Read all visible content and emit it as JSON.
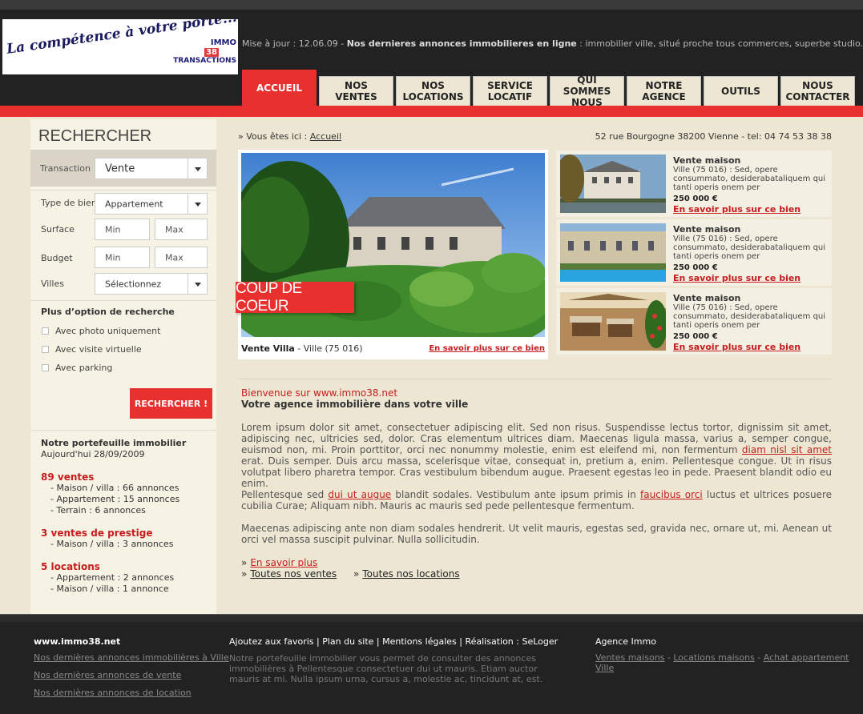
{
  "header": {
    "logo_slogan": "La compétence à votre porte...",
    "logo_line1": "IMMO",
    "logo_line2": "38",
    "logo_line3": "TRANSACTIONS",
    "news_prefix": "Mise à jour : 12.06.09   -   ",
    "news_title": "Nos dernieres annonces immobilieres en ligne",
    "news_text": " : immobilier ville, situé proche tous commerces, superbe studio..."
  },
  "nav": [
    {
      "l1": "ACCUEIL",
      "l2": ""
    },
    {
      "l1": "NOS",
      "l2": "VENTES"
    },
    {
      "l1": "NOS",
      "l2": "LOCATIONS"
    },
    {
      "l1": "SERVICE",
      "l2": "LOCATIF"
    },
    {
      "l1": "QUI",
      "l2": "SOMMES NOUS"
    },
    {
      "l1": "NOTRE",
      "l2": "AGENCE"
    },
    {
      "l1": "OUTILS",
      "l2": ""
    },
    {
      "l1": "NOUS",
      "l2": "CONTACTER"
    }
  ],
  "sidebar": {
    "title": "RECHERCHER",
    "transaction_label": "Transaction",
    "transaction_value": "Vente",
    "type_label": "Type de bien",
    "type_value": "Appartement",
    "surface_label": "Surface",
    "budget_label": "Budget",
    "villes_label": "Villes",
    "villes_value": "Sélectionnez",
    "min": "Min",
    "max": "Max",
    "options_title": "Plus d’option de recherche",
    "opt1": "Avec photo uniquement",
    "opt2": "Avec visite virtuelle",
    "opt3": "Avec parking",
    "search_button": "RECHERCHER !",
    "portfolio_title": "Notre portefeuille immobilier",
    "portfolio_date": "Aujourd'hui 28/09/2009",
    "ventes_head": "89  ventes",
    "ventes_items": [
      "- Maison / villa : 66 annonces",
      "- Appartement : 15 annonces",
      "- Terrain : 6 annonces"
    ],
    "prestige_head": "3 ventes de prestige",
    "prestige_items": [
      "- Maison / villa : 3 annonces"
    ],
    "locations_head": "5  locations",
    "locations_items": [
      "- Appartement : 2 annonces",
      "- Maison / villa : 1 annonce"
    ]
  },
  "main": {
    "crumb_prefix": "Vous êtes ici : ",
    "crumb_link": "Accueil",
    "address": "52 rue Bourgogne 38200 Vienne - tel: 04 74 53 38 38",
    "feature_badge": "COUP DE COEUR",
    "feature_title": "Vente Villa",
    "feature_place": " - Ville (75 016)",
    "feature_more": "En savoir plus sur ce bien",
    "listings": [
      {
        "title": "Vente maison",
        "desc": "Ville (75 016) : Sed, opere consummato, desiderabataliquem qui tanti operis onem per",
        "price": "250 000 €",
        "more": "En savoir plus sur ce bien"
      },
      {
        "title": "Vente maison",
        "desc": "Ville (75 016) : Sed, opere consummato, desiderabataliquem qui tanti operis onem per",
        "price": "250 000 €",
        "more": "En savoir plus sur ce bien"
      },
      {
        "title": "Vente maison",
        "desc": "Ville (75 016) : Sed, opere consummato, desiderabataliquem qui tanti operis onem per",
        "price": "250 000 €",
        "more": "En savoir plus sur ce bien"
      }
    ],
    "welcome": "Bienvenue sur www.immo38.net",
    "subtitle": "Votre agence immobilière dans votre ville",
    "p1a": "Lorem ipsum dolor sit amet, consectetuer adipiscing elit. Sed non risus. Suspendisse lectus tortor, dignissim sit amet, adipiscing nec, ultricies sed, dolor. Cras elementum ultrices diam. Maecenas ligula massa, varius a, semper congue, euismod non, mi. Proin porttitor, orci nec nonummy molestie, enim est eleifend mi, non fermentum ",
    "p1link": "diam nisl sit amet",
    "p1b": " erat. Duis semper. Duis arcu massa, scelerisque vitae, consequat in, pretium a, enim. Pellentesque congue. Ut in risus volutpat libero pharetra tempor. Cras vestibulum bibendum augue. Praesent egestas leo in pede. Praesent blandit odio eu enim.",
    "p2a": "Pellentesque sed ",
    "p2link1": "dui ut augue",
    "p2b": " blandit sodales. Vestibulum ante ipsum primis in ",
    "p2link2": "faucibus orci",
    "p2c": " luctus et ultrices posuere cubilia Curae; Aliquam nibh. Mauris ac mauris sed pede pellentesque fermentum.",
    "p3": "Maecenas adipiscing ante non diam sodales hendrerit. Ut velit mauris, egestas sed, gravida nec, ornare ut, mi. Aenean ut orci vel massa suscipit pulvinar. Nulla sollicitudin.",
    "link_more": "En savoir plus",
    "link_ventes": "Toutes nos ventes",
    "link_locations": "Toutes nos locations",
    "chevron": "»"
  },
  "footer": {
    "site": "www.immo38.net",
    "col1": [
      "Nos dernières annonces immobilières à Ville",
      "Nos dernières annonces de vente",
      "Nos dernières annonces de location"
    ],
    "menu": "Ajoutez aux favoris  |  Plan du site  |  Mentions légales  |  Réalisation : SeLoger",
    "text": "Notre portefeuille immobilier vous permet de consulter des annonces immobilières à Pellentesque consectetuer dui ut mauris. Etiam auctor mauris at mi. Nulla ipsum urna, cursus a, molestie ac, tincidunt at, est.",
    "agence": "Agence Immo",
    "links3": [
      "Ventes maisons",
      "Locations maisons",
      "Achat appartement Ville"
    ],
    "sep": " - "
  },
  "colors": {
    "accent": "#e8312e",
    "dark": "#222222",
    "beige": "#ece6d2"
  }
}
